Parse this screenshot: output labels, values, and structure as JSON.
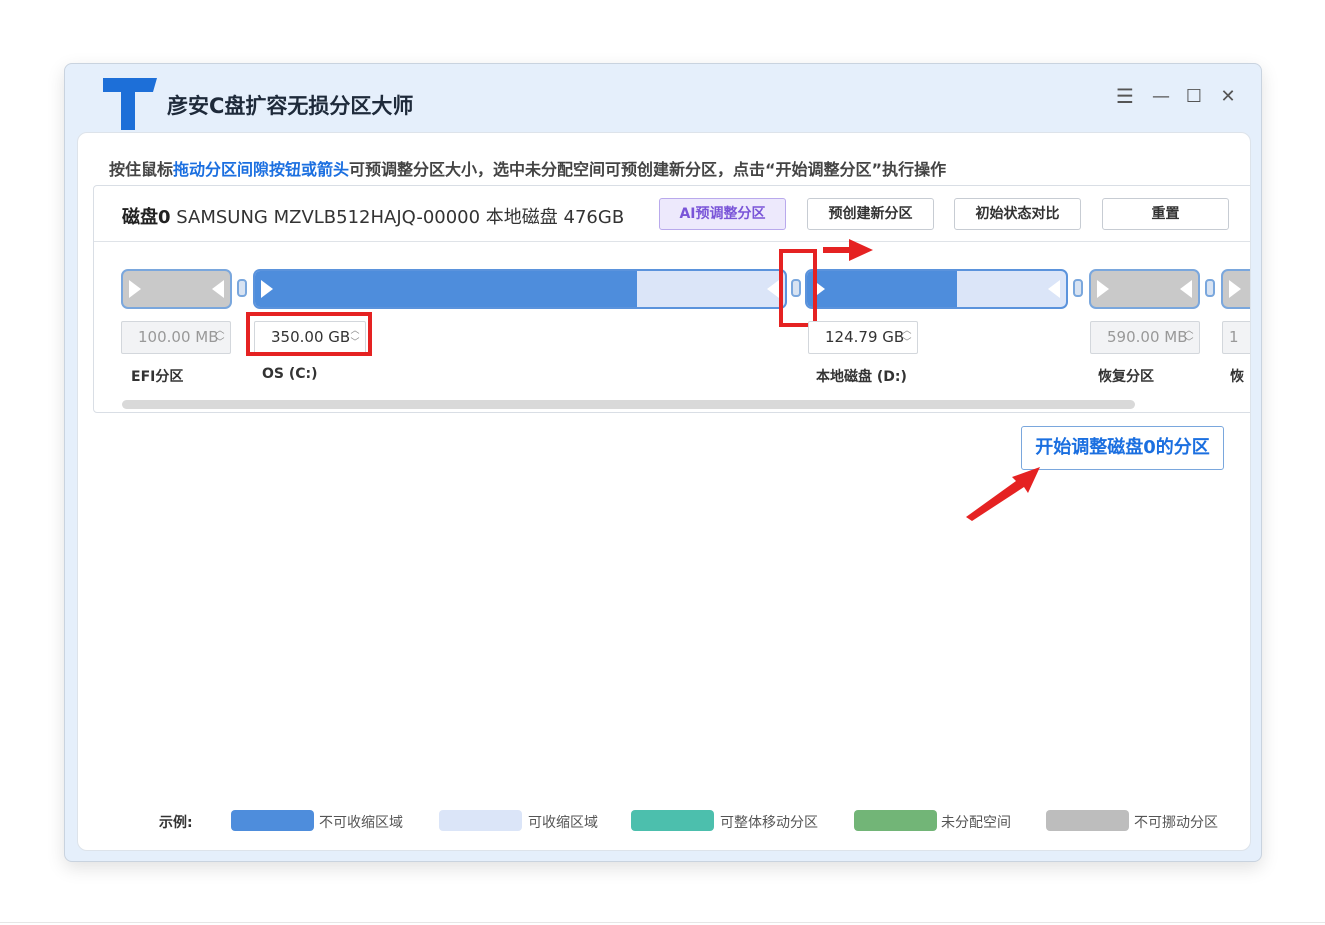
{
  "window": {
    "title": "彦安C盘扩容无损分区大师",
    "controls": {
      "menu": "☰",
      "minimize": "—",
      "maximize": "☐",
      "close": "✕"
    }
  },
  "instruction": {
    "prefix": "按住鼠标",
    "highlight": "拖动分区间隙按钮或箭头",
    "suffix": "可预调整分区大小，选中未分配空间可预创建新分区，点击“开始调整分区”执行操作"
  },
  "disk": {
    "name": "磁盘0",
    "info": " SAMSUNG MZVLB512HAJQ-00000 本地磁盘 476GB",
    "buttons": {
      "ai_adjust": "AI预调整分区",
      "pre_create": "预创建新分区",
      "compare": "初始状态对比",
      "reset": "重置"
    },
    "partitions": [
      {
        "size": "100.00 MB",
        "label": "EFI分区",
        "type": "fixed"
      },
      {
        "size": "350.00 GB",
        "label": "OS (C:)",
        "type": "resizable",
        "used_fraction": 0.72
      },
      {
        "size": "124.79 GB",
        "label": "本地磁盘 (D:)",
        "type": "resizable",
        "used_fraction": 0.58
      },
      {
        "size": "590.00 MB",
        "label": "恢复分区",
        "type": "fixed"
      },
      {
        "size": "1",
        "label": "恢",
        "type": "fixed"
      }
    ]
  },
  "start_button": "开始调整磁盘0的分区",
  "legend": {
    "title": "示例:",
    "items": [
      {
        "label": "不可收缩区域",
        "color": "#4e8ddc"
      },
      {
        "label": "可收缩区域",
        "color": "#dbe5f8"
      },
      {
        "label": "可整体移动分区",
        "color": "#4cbfad"
      },
      {
        "label": "未分配空间",
        "color": "#72b577"
      },
      {
        "label": "不可挪动分区",
        "color": "#bdbdbd"
      }
    ]
  }
}
